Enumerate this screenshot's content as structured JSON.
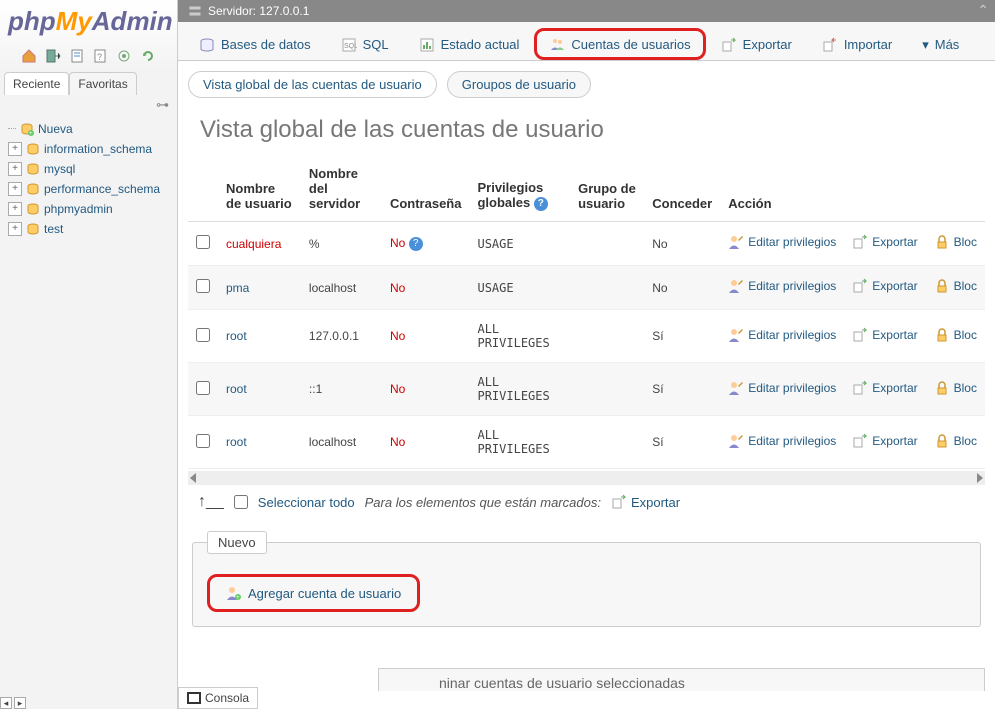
{
  "logo": {
    "p1": "php",
    "p2": "My",
    "p3": "Admin"
  },
  "sidebar": {
    "tabs": {
      "recent": "Reciente",
      "favorites": "Favoritas"
    },
    "tree": [
      {
        "label": "Nueva",
        "type": "new"
      },
      {
        "label": "information_schema",
        "type": "db"
      },
      {
        "label": "mysql",
        "type": "db"
      },
      {
        "label": "performance_schema",
        "type": "db"
      },
      {
        "label": "phpmyadmin",
        "type": "db"
      },
      {
        "label": "test",
        "type": "db"
      }
    ]
  },
  "server": {
    "label": "Servidor: 127.0.0.1"
  },
  "toptabs": {
    "databases": "Bases de datos",
    "sql": "SQL",
    "status": "Estado actual",
    "users": "Cuentas de usuarios",
    "export": "Exportar",
    "import": "Importar",
    "more": "Más"
  },
  "subtabs": {
    "overview": "Vista global de las cuentas de usuario",
    "groups": "Groupos de usuario"
  },
  "title": "Vista global de las cuentas de usuario",
  "table": {
    "headers": {
      "username": "Nombre de usuario",
      "hostname": "Nombre del servidor",
      "password": "Contraseña",
      "global_priv": "Privilegios globales",
      "usergroup": "Grupo de usuario",
      "grant": "Conceder",
      "action": "Acción"
    },
    "rows": [
      {
        "user": "cualquiera",
        "user_red": true,
        "host": "%",
        "pass": "No",
        "pass_help": true,
        "priv": "USAGE",
        "grant": "No"
      },
      {
        "user": "pma",
        "host": "localhost",
        "pass": "No",
        "priv": "USAGE",
        "grant": "No"
      },
      {
        "user": "root",
        "host": "127.0.0.1",
        "pass": "No",
        "priv": "ALL PRIVILEGES",
        "grant": "Sí"
      },
      {
        "user": "root",
        "host": "::1",
        "pass": "No",
        "priv": "ALL PRIVILEGES",
        "grant": "Sí"
      },
      {
        "user": "root",
        "host": "localhost",
        "pass": "No",
        "priv": "ALL PRIVILEGES",
        "grant": "Sí"
      }
    ],
    "action_edit": "Editar privilegios",
    "action_export": "Exportar",
    "action_lock": "Bloc"
  },
  "selectall": {
    "label": "Seleccionar todo",
    "marked": "Para los elementos que están marcados:",
    "export": "Exportar"
  },
  "new_section": {
    "legend": "Nuevo",
    "add_user": "Agregar cuenta de usuario"
  },
  "delete_section": "ninar cuentas de usuario seleccionadas",
  "console": "Consola"
}
